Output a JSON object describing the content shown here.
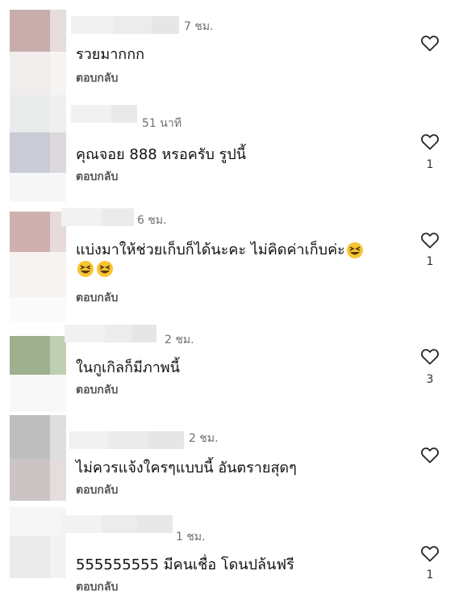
{
  "comments": [
    {
      "time": "7 ชม.",
      "text": "รวยมากกก",
      "reply": "ตอบกลับ",
      "likes": "",
      "icon": "heart-outline-icon"
    },
    {
      "time": "51 นาที",
      "text": "คุณจอย 888 หรอครับ รูปนี้",
      "reply": "ตอบกลับ",
      "likes": "1",
      "icon": "heart-outline-icon"
    },
    {
      "time": "6 ชม.",
      "text": "แบ่งมาให้ช่วยเก็บก็ได้นะคะ  ไม่คิดค่าเก็บค่ะ",
      "reply": "ตอบกลับ",
      "likes": "1",
      "icon": "heart-outline-icon",
      "emoji": "grinning-squinting-face"
    },
    {
      "time": "2 ชม.",
      "text": "ในกูเกิลก็มีภาพนี้",
      "reply": "ตอบกลับ",
      "likes": "3",
      "icon": "heart-outline-icon"
    },
    {
      "time": "2 ชม.",
      "text": "ไม่ควรแจ้งใครๆแบบนี้ อันตรายสุดๆ",
      "reply": "ตอบกลับ",
      "likes": "",
      "icon": "heart-outline-icon"
    },
    {
      "time": "1 ชม.",
      "text": "555555555 มีคนเชื่อ โดนปล้นฟรี",
      "reply": "ตอบกลับ",
      "likes": "1",
      "icon": "heart-outline-icon"
    }
  ]
}
